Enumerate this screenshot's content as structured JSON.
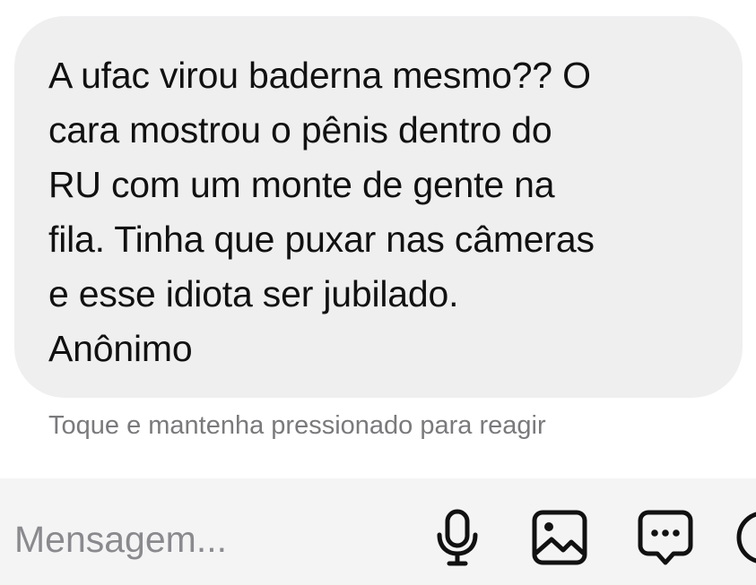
{
  "message": {
    "body": "A ufac virou baderna mesmo?? O\ncara mostrou o pênis dentro do\nRU com um monte de gente na\nfila. Tinha que puxar nas câmeras\ne esse idiota ser jubilado.",
    "signature": "Anônimo",
    "bubble_color": "#efeff0"
  },
  "hint": {
    "text": "Toque e mantenha pressionado para reagir"
  },
  "composer": {
    "placeholder": "Mensagem...",
    "value": "",
    "icons": [
      "microphone-icon",
      "image-icon",
      "chat-bubble-icon",
      "more-icon"
    ]
  }
}
